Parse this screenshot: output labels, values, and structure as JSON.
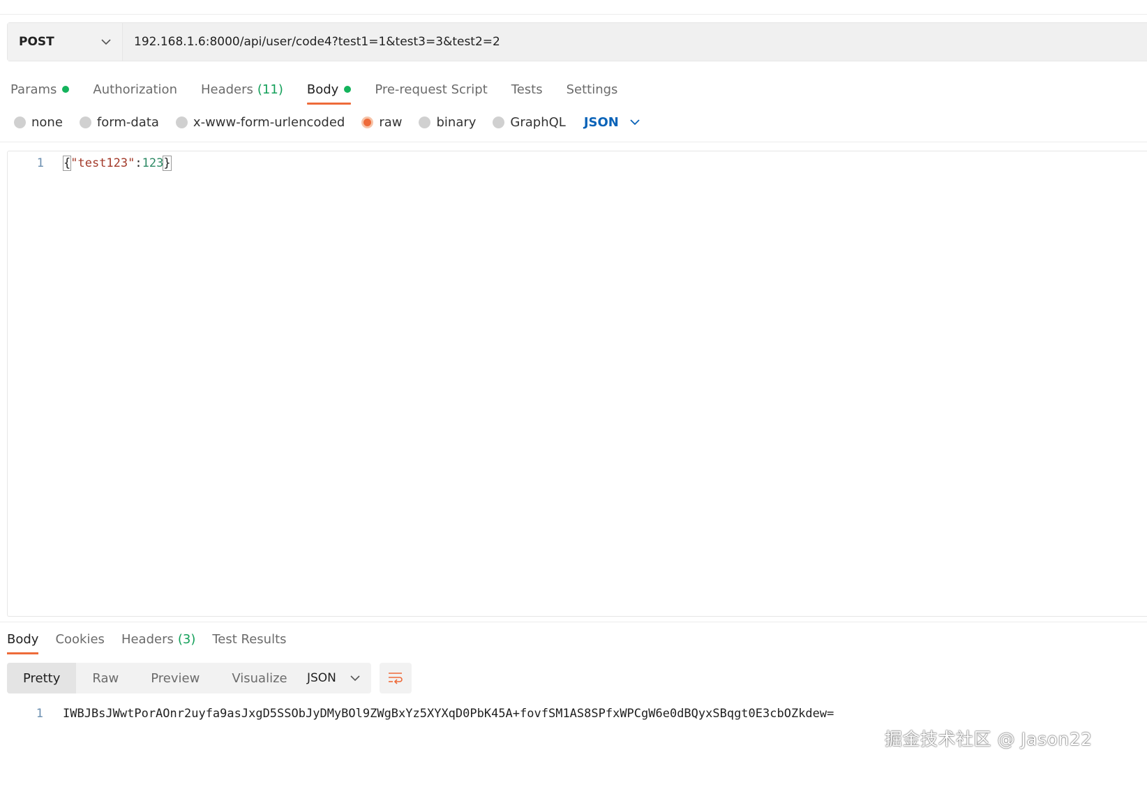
{
  "request": {
    "method": "POST",
    "url": "192.168.1.6:8000/api/user/code4?test1=1&test3=3&test2=2"
  },
  "request_tabs": [
    {
      "label": "Params",
      "dot": true,
      "active": false
    },
    {
      "label": "Authorization",
      "active": false
    },
    {
      "label": "Headers",
      "count": "(11)",
      "active": false
    },
    {
      "label": "Body",
      "dot": true,
      "active": true
    },
    {
      "label": "Pre-request Script",
      "active": false
    },
    {
      "label": "Tests",
      "active": false
    },
    {
      "label": "Settings",
      "active": false
    }
  ],
  "body_types": [
    {
      "label": "none",
      "selected": false
    },
    {
      "label": "form-data",
      "selected": false
    },
    {
      "label": "x-www-form-urlencoded",
      "selected": false
    },
    {
      "label": "raw",
      "selected": true
    },
    {
      "label": "binary",
      "selected": false
    },
    {
      "label": "GraphQL",
      "selected": false
    }
  ],
  "body_language": "JSON",
  "editor": {
    "line_number": "1",
    "open_brace": "{",
    "key": "\"test123\"",
    "colon": ":",
    "value": "123",
    "close_brace": "}"
  },
  "response_tabs": [
    {
      "label": "Body",
      "active": true
    },
    {
      "label": "Cookies",
      "active": false
    },
    {
      "label": "Headers",
      "count": "(3)",
      "active": false
    },
    {
      "label": "Test Results",
      "active": false
    }
  ],
  "view_modes": [
    {
      "label": "Pretty",
      "active": true
    },
    {
      "label": "Raw",
      "active": false
    },
    {
      "label": "Preview",
      "active": false
    },
    {
      "label": "Visualize",
      "active": false
    }
  ],
  "response_format": "JSON",
  "response": {
    "line_number": "1",
    "content": "IWBJBsJWwtPorAOnr2uyfa9asJxgD5SSObJyDMyBOl9ZWgBxYz5XYXqD0PbK45A+fovfSM1AS8SPfxWPCgW6e0dBQyxSBqgt0E3cbOZkdew="
  },
  "watermark": "掘金技术社区 @ Jason22",
  "colors": {
    "accent": "#ee6b3a",
    "dot_green": "#14b35c",
    "link_blue": "#0a63b8"
  }
}
